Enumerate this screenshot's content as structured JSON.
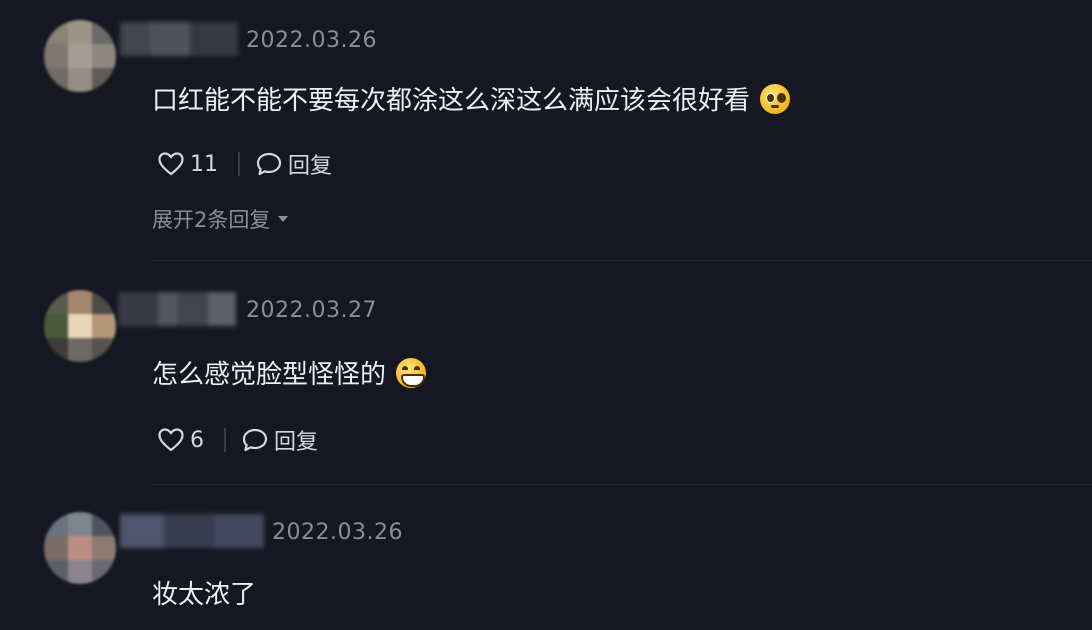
{
  "colors": {
    "background": "#151722",
    "text_primary": "#eceef3",
    "text_secondary": "#8b8d97"
  },
  "comments": [
    {
      "date": "2022.03.26",
      "text": "口红能不能不要每次都涂这么深这么满应该会很好看",
      "emoji": "pleading-face-icon",
      "likes": "11",
      "reply_label": "回复",
      "expand_label": "展开2条回复"
    },
    {
      "date": "2022.03.27",
      "text": "怎么感觉脸型怪怪的",
      "emoji": "grinning-face-icon",
      "likes": "6",
      "reply_label": "回复"
    },
    {
      "date": "2022.03.26",
      "text": "妆太浓了"
    }
  ]
}
